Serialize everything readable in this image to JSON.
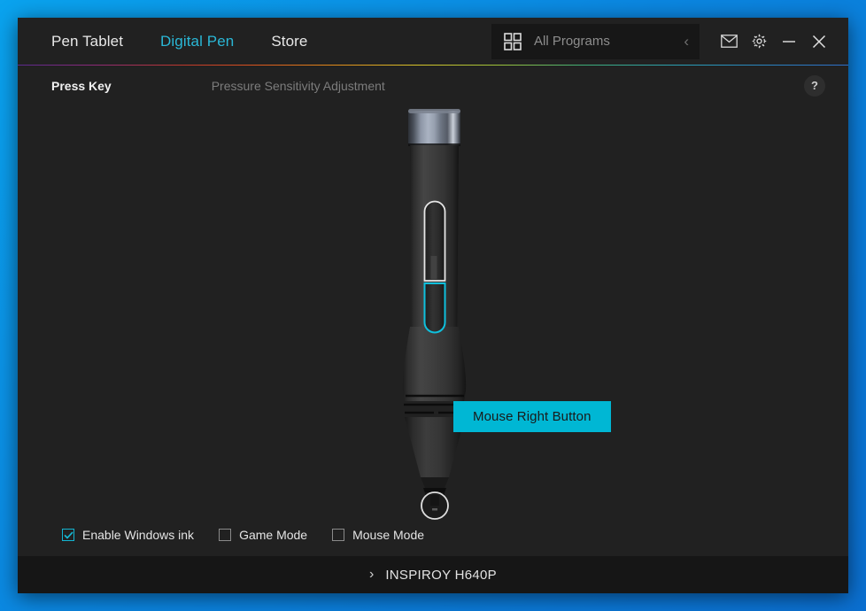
{
  "window": {
    "nav_tabs": [
      {
        "label": "Pen Tablet",
        "active": false
      },
      {
        "label": "Digital Pen",
        "active": true
      },
      {
        "label": "Store",
        "active": false
      }
    ],
    "all_programs": {
      "label": "All Programs",
      "grid_icon": "grid-icon",
      "collapse_chevron": "‹"
    },
    "controls": {
      "mail_icon": "mail-icon",
      "settings_icon": "gear-icon",
      "minimize_icon": "minimize-icon",
      "close_icon": "close-icon"
    }
  },
  "subheader": {
    "tabs": [
      {
        "label": "Press Key",
        "active": true
      },
      {
        "label": "Pressure Sensitivity Adjustment",
        "active": false
      }
    ],
    "help_label": "?"
  },
  "stage": {
    "pen_callout_label": "Mouse Right Button",
    "highlighted_button": "lower-barrel-button",
    "accent_color": "#00b7d4"
  },
  "options": [
    {
      "label": "Enable Windows ink",
      "checked": true
    },
    {
      "label": "Game Mode",
      "checked": false
    },
    {
      "label": "Mouse Mode",
      "checked": false
    }
  ],
  "footer": {
    "chevron": "›",
    "device_name": "INSPIROY H640P"
  },
  "colors": {
    "accent": "#00b7d4",
    "window_bg": "#212121",
    "footer_bg": "#161616",
    "desktop_bg": "#0b86e0"
  }
}
